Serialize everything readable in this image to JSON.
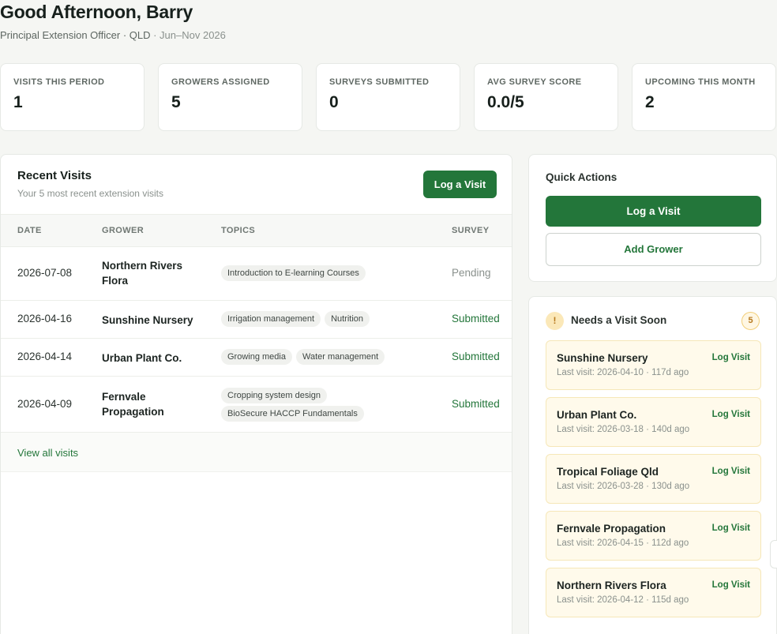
{
  "header": {
    "greeting": "Good Afternoon, Barry",
    "role": "Principal Extension Officer · QLD",
    "period": " · Jun–Nov 2026"
  },
  "stats": [
    {
      "label": "VISITS THIS PERIOD",
      "value": "1"
    },
    {
      "label": "GROWERS ASSIGNED",
      "value": "5"
    },
    {
      "label": "SURVEYS SUBMITTED",
      "value": "0"
    },
    {
      "label": "AVG SURVEY SCORE",
      "value": "0.0/5"
    },
    {
      "label": "UPCOMING THIS MONTH",
      "value": "2"
    }
  ],
  "recent_visits": {
    "title": "Recent Visits",
    "subtitle": "Your 5 most recent extension visits",
    "log_button": "Log a Visit",
    "columns": {
      "date": "DATE",
      "grower": "GROWER",
      "topics": "TOPICS",
      "survey": "SURVEY"
    },
    "rows": [
      {
        "date": "2026-07-08",
        "grower": "Northern Rivers Flora",
        "topics": [
          "Introduction to E-learning Courses"
        ],
        "survey": "Pending"
      },
      {
        "date": "2026-04-16",
        "grower": "Sunshine Nursery",
        "topics": [
          "Irrigation management",
          "Nutrition"
        ],
        "survey": "Submitted"
      },
      {
        "date": "2026-04-14",
        "grower": "Urban Plant Co.",
        "topics": [
          "Growing media",
          "Water management"
        ],
        "survey": "Submitted"
      },
      {
        "date": "2026-04-09",
        "grower": "Fernvale Propagation",
        "topics": [
          "Cropping system design",
          "BioSecure HACCP Fundamentals"
        ],
        "survey": "Submitted"
      }
    ],
    "view_all": "View all visits"
  },
  "quick_actions": {
    "title": "Quick Actions",
    "log_visit": "Log a Visit",
    "add_grower": "Add Grower"
  },
  "needs_visit": {
    "title": "Needs a Visit Soon",
    "icon": "!",
    "count": "5",
    "link_label": "Log Visit",
    "items": [
      {
        "name": "Sunshine Nursery",
        "last": "Last visit: 2026-04-10 · 117d ago"
      },
      {
        "name": "Urban Plant Co.",
        "last": "Last visit: 2026-03-18 · 140d ago"
      },
      {
        "name": "Tropical Foliage Qld",
        "last": "Last visit: 2026-03-28 · 130d ago"
      },
      {
        "name": "Fernvale Propagation",
        "last": "Last visit: 2026-04-15 · 112d ago"
      },
      {
        "name": "Northern Rivers Flora",
        "last": "Last visit: 2026-04-12 · 115d ago"
      }
    ]
  },
  "colors": {
    "accent": "#23763a",
    "warning": "#b7791f",
    "background": "#f5f6f3"
  }
}
